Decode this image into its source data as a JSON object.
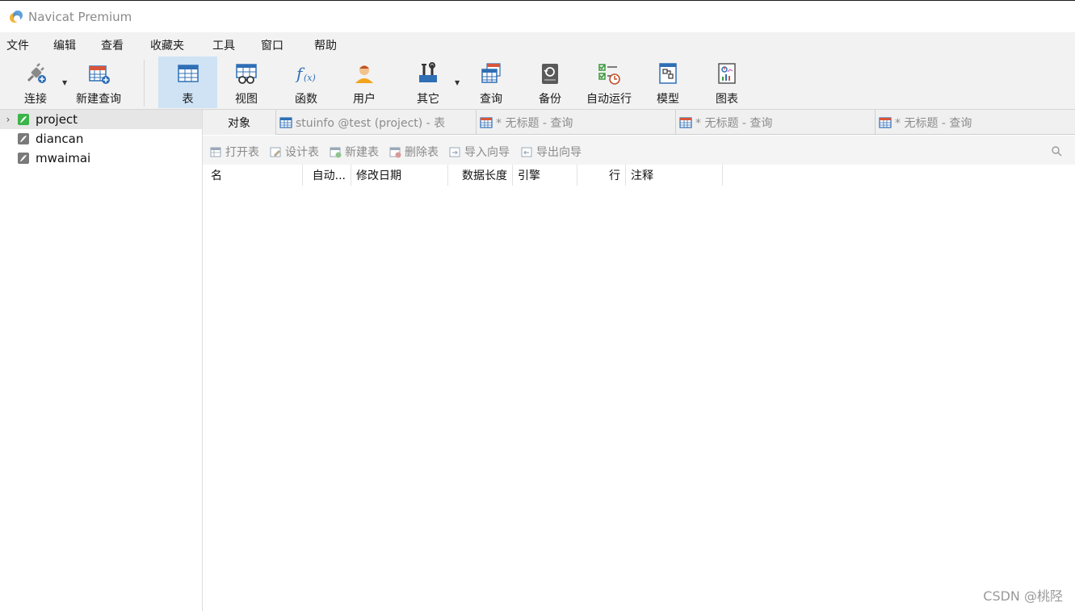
{
  "window": {
    "title": "Navicat Premium"
  },
  "menu": [
    "文件",
    "编辑",
    "查看",
    "收藏夹",
    "工具",
    "窗口",
    "帮助"
  ],
  "toolbar": {
    "connect": "连接",
    "new_query": "新建查询",
    "table": "表",
    "view": "视图",
    "function": "函数",
    "user": "用户",
    "other": "其它",
    "query": "查询",
    "backup": "备份",
    "automation": "自动运行",
    "model": "模型",
    "chart": "图表"
  },
  "sidebar": {
    "items": [
      {
        "label": "project",
        "selected": true
      },
      {
        "label": "diancan",
        "selected": false
      },
      {
        "label": "mwaimai",
        "selected": false
      }
    ]
  },
  "tabs": {
    "objects": "对象",
    "docs": [
      {
        "label": "stuinfo @test (project) - 表"
      },
      {
        "label": "* 无标题 - 查询"
      },
      {
        "label": "* 无标题 - 查询"
      },
      {
        "label": "* 无标题 - 查询"
      }
    ]
  },
  "object_toolbar": {
    "open_table": "打开表",
    "design_table": "设计表",
    "new_table": "新建表",
    "delete_table": "删除表",
    "import_wizard": "导入向导",
    "export_wizard": "导出向导"
  },
  "columns": [
    "名",
    "自动...",
    "修改日期",
    "数据长度",
    "引擎",
    "行",
    "注释"
  ],
  "watermark": "CSDN @桃陉",
  "colors": {
    "active_tool": "#cfe3f5",
    "accent": "#2f6fb5"
  }
}
